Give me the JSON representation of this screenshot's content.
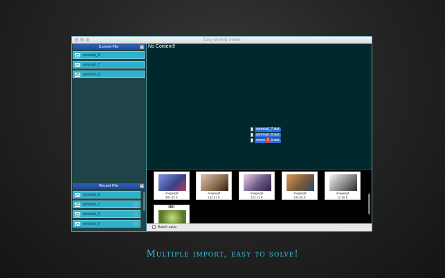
{
  "window": {
    "title": "Easy winmail viewer"
  },
  "current_section": {
    "header": "Current File",
    "collapse_glyph": "–",
    "files": [
      {
        "label": "winmail_8"
      },
      {
        "label": "winmail_7"
      },
      {
        "label": "winmail_9"
      }
    ]
  },
  "recent_section": {
    "header": "Recent File",
    "collapse_glyph": "–",
    "files": [
      {
        "label": "winmail_8"
      },
      {
        "label": "winmail_7"
      },
      {
        "label": "winmail_9"
      },
      {
        "label": "winmail_5"
      }
    ]
  },
  "main": {
    "no_content": "No Content!!",
    "drag": {
      "items": [
        "winmail_7.dat",
        "winmail_8.dat",
        "winmail_9.dat"
      ],
      "count": "3"
    }
  },
  "thumbnails": [
    {
      "type": "image/gif",
      "size": "482.82 K",
      "icon": "image-thumbnail-icon",
      "color": "#5a6fb0"
    },
    {
      "type": "image/gif",
      "size": "132.51 K",
      "icon": "image-thumbnail-icon",
      "color": "#a5866a"
    },
    {
      "type": "image/gif",
      "size": "122.12 K",
      "icon": "image-thumbnail-icon",
      "color": "#8a6aa0"
    },
    {
      "type": "image/gif",
      "size": "132.65 K",
      "icon": "image-thumbnail-icon",
      "color": "#b0804a"
    },
    {
      "type": "image/gif",
      "size": "12.38 K",
      "icon": "image-thumbnail-icon",
      "color": "#9a9a9a"
    },
    {
      "label": "OK!",
      "icon": "image-thumbnail-icon",
      "color": "#7a9a3a"
    }
  ],
  "batch": {
    "label": "Batch save"
  },
  "tagline": "Multiple import, easy to solve!"
}
